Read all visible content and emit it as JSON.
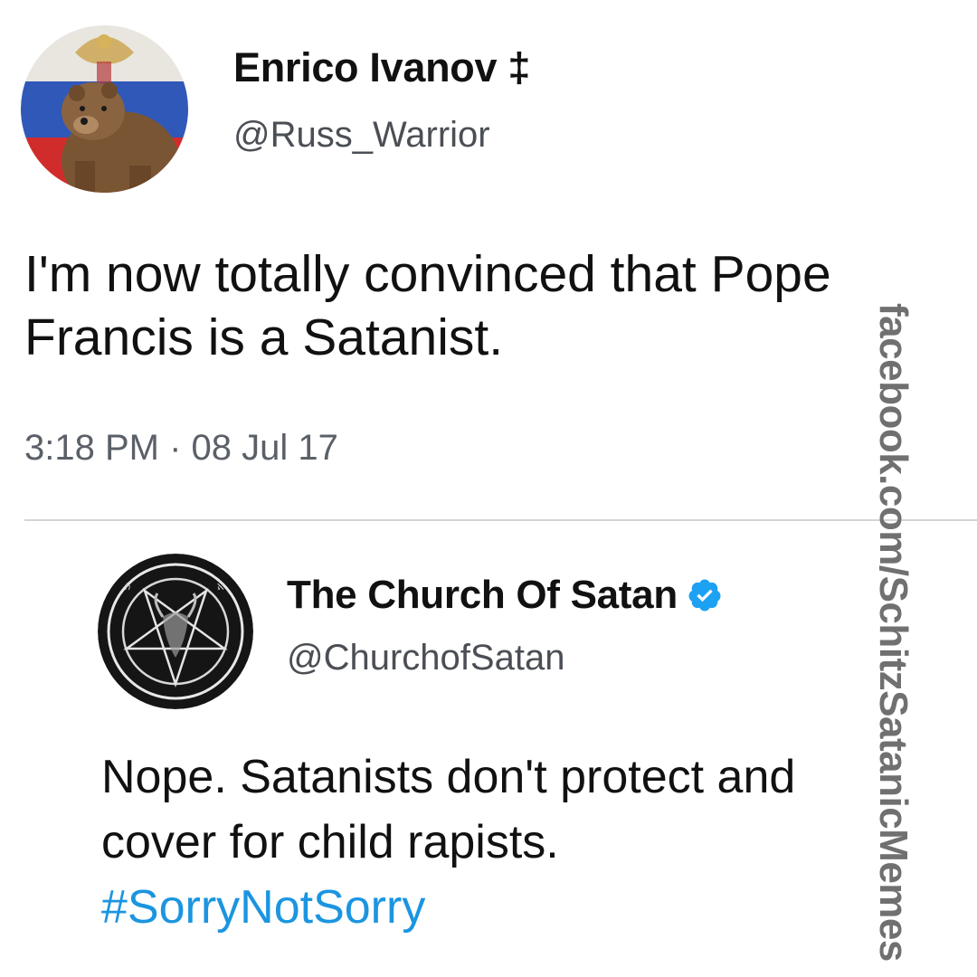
{
  "tweet": {
    "author_name": "Enrico Ivanov ‡",
    "author_handle": "@Russ_Warrior",
    "avatar": "bear-russian-flag-avatar",
    "text": "I'm now totally convinced that Pope Francis is a Satanist.",
    "time": "3:18 PM · 08 Jul 17"
  },
  "reply": {
    "author_name": "The Church Of Satan",
    "author_handle": "@ChurchofSatan",
    "avatar": "baphomet-sigil-avatar",
    "verified_icon": "verified-badge-icon",
    "text": "Nope. Satanists don't protect and cover for child rapists.",
    "hashtag": "#SorryNotSorry"
  },
  "watermark": {
    "text": "facebook.com/SchitzSatanicMemes"
  },
  "colors": {
    "hashtag": "#1b95e0",
    "verified": "#1da1f2",
    "divider": "#d2d5d9",
    "secondary_text": "#5b6068",
    "watermark": "#707070"
  }
}
